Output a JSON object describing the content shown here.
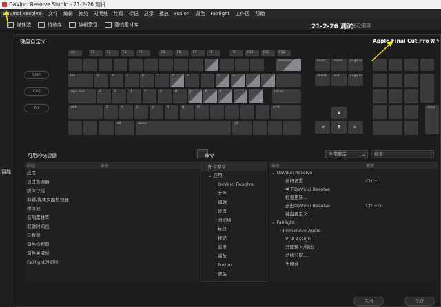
{
  "window": {
    "title": "DaVinci Resolve Studio - 21-2-26 测试"
  },
  "menu": [
    "DaVinci Resolve",
    "文件",
    "编辑",
    "修剪",
    "时间线",
    "片段",
    "标记",
    "显示",
    "播放",
    "Fusion",
    "调色",
    "Fairlight",
    "工作区",
    "帮助"
  ],
  "toolbar": {
    "items": [
      "媒体池",
      "特效库",
      "编辑索引",
      "音响素材库"
    ],
    "project_name": "21-2-26 测试",
    "edited_status": "经过编辑"
  },
  "left_strip": {
    "label": "智能"
  },
  "dialog": {
    "title": "键盘自定义",
    "preset": "Apple Final Cut Pro X",
    "modifiers": [
      "Shift",
      "Ctrl",
      "Alt"
    ],
    "keys": {
      "esc": "esc",
      "f1": "F1",
      "f2": "F2",
      "f3": "F3",
      "f4": "F4",
      "f5": "F5",
      "f6": "F6",
      "f7": "F7",
      "f8": "F8",
      "f9": "F9",
      "f10": "F10",
      "f11": "F11",
      "f12": "F12",
      "backspace": "backspace",
      "tab": "tab",
      "q": "Q",
      "w": "W",
      "e": "E",
      "r": "R",
      "t": "T",
      "y": "Y",
      "u": "U",
      "i": "I",
      "o": "O",
      "p": "P",
      "caps": "caps lock",
      "a": "A",
      "s": "S",
      "d": "D",
      "f": "F",
      "g": "G",
      "h": "H",
      "j": "J",
      "k": "K",
      "l": "L",
      "return": "return",
      "lshift": "shift",
      "z": "Z",
      "x": "X",
      "c": "C",
      "v": "V",
      "b": "B",
      "n": "N",
      "m": "M",
      "rshift": "shift",
      "alt_l": "alt",
      "space": "space",
      "alt_r": "alt",
      "insert": "insert",
      "home": "home",
      "pageup": "page up",
      "delete": "delete",
      "end": "end",
      "pagedown": "page down",
      "enter": "enter",
      "up": "▲",
      "left": "◄",
      "down": "▼",
      "right": "►"
    },
    "shortcuts_panel": {
      "title": "可用的快捷键",
      "col_group": "群组",
      "col_command": "命令",
      "rows": [
        "应用",
        "项目管理器",
        "媒体存储",
        "剪辑/媒体页面检视器",
        "媒体池",
        "音响素材库",
        "剪辑时间线",
        "元数据",
        "调色检视器",
        "调色关键帧",
        "Fairlight时间线"
      ]
    },
    "commands_panel": {
      "title": "命令",
      "filter": "全部显示",
      "search_placeholder": "搜索",
      "categories": [
        {
          "label": "所有命令",
          "indent": 0
        },
        {
          "label": "应用",
          "indent": 0
        },
        {
          "label": "DaVinci Resolve",
          "indent": 1
        },
        {
          "label": "文件",
          "indent": 1
        },
        {
          "label": "编辑",
          "indent": 1
        },
        {
          "label": "修剪",
          "indent": 1
        },
        {
          "label": "时间线",
          "indent": 1
        },
        {
          "label": "片段",
          "indent": 1
        },
        {
          "label": "标记",
          "indent": 1
        },
        {
          "label": "显示",
          "indent": 1
        },
        {
          "label": "播放",
          "indent": 1
        },
        {
          "label": "Fusion",
          "indent": 1
        },
        {
          "label": "调色",
          "indent": 1
        }
      ],
      "col_command": "命令",
      "col_key": "按键",
      "commands": [
        {
          "label": "DaVinci Resolve",
          "level": 0,
          "shortcut": ""
        },
        {
          "label": "偏好设置...",
          "level": 2,
          "shortcut": "Ctrl+,"
        },
        {
          "label": "关于DaVinci Resolve",
          "level": 2,
          "shortcut": ""
        },
        {
          "label": "检查更新...",
          "level": 2,
          "shortcut": ""
        },
        {
          "label": "退出DaVinci Resolve",
          "level": 2,
          "shortcut": "Ctrl+Q"
        },
        {
          "label": "键盘自定义...",
          "level": 2,
          "shortcut": ""
        },
        {
          "label": "Fairlight",
          "level": 0,
          "shortcut": ""
        },
        {
          "label": "Immersive Audio",
          "level": 1,
          "shortcut": ""
        },
        {
          "label": "VCA Assign...",
          "level": 2,
          "shortcut": ""
        },
        {
          "label": "分配输入/输出...",
          "level": 2,
          "shortcut": ""
        },
        {
          "label": "总线分配...",
          "level": 2,
          "shortcut": ""
        },
        {
          "label": "半静音",
          "level": 2,
          "shortcut": ""
        }
      ]
    },
    "buttons": {
      "close": "关闭",
      "save": "保存"
    }
  },
  "colors": {
    "annotation_arrow": "#f5e400",
    "highlight_key": "#8a8a8e"
  }
}
